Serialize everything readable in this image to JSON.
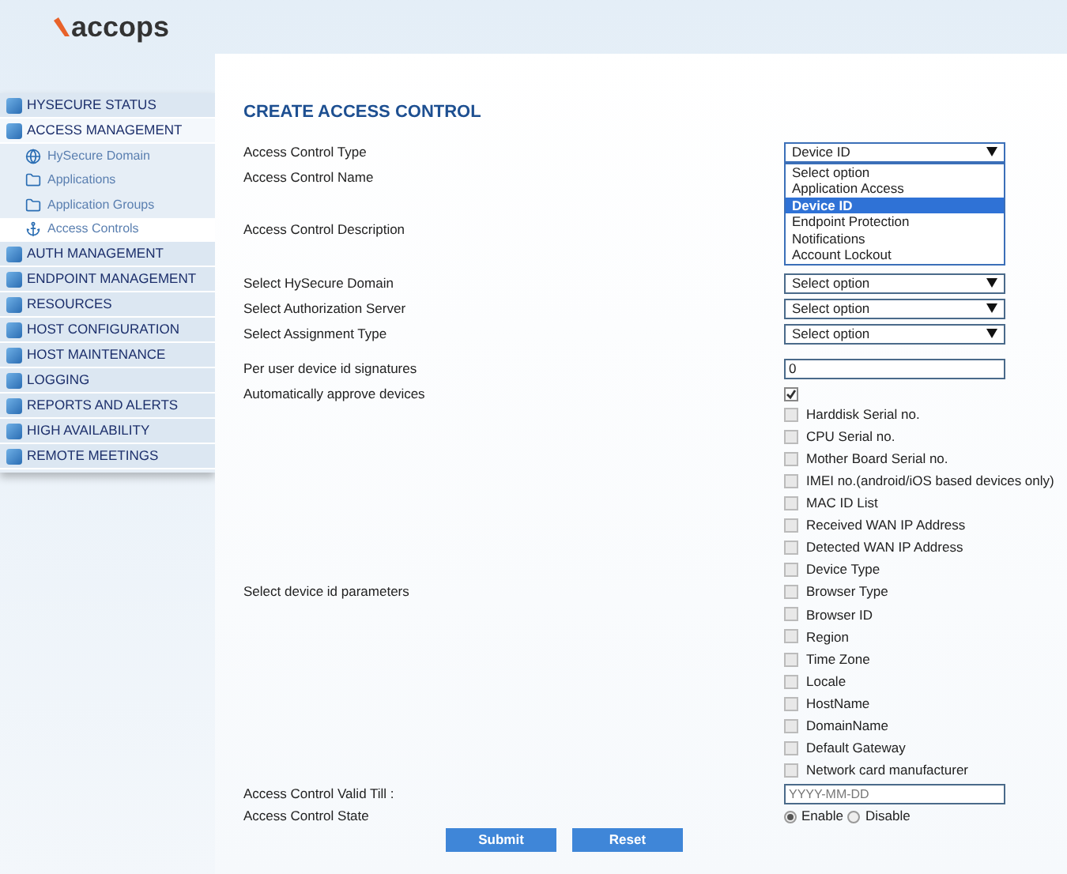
{
  "logo": "accops",
  "sidebar": {
    "items": [
      {
        "label": "HYSECURE STATUS",
        "expanded": false
      },
      {
        "label": "ACCESS MANAGEMENT",
        "expanded": true,
        "children": [
          {
            "label": "HySecure Domain",
            "selected": false
          },
          {
            "label": "Applications",
            "selected": false
          },
          {
            "label": "Application Groups",
            "selected": false
          },
          {
            "label": "Access Controls",
            "selected": true
          }
        ]
      },
      {
        "label": "AUTH MANAGEMENT",
        "expanded": false
      },
      {
        "label": "ENDPOINT MANAGEMENT",
        "expanded": false
      },
      {
        "label": "RESOURCES",
        "expanded": false
      },
      {
        "label": "HOST CONFIGURATION",
        "expanded": false
      },
      {
        "label": "HOST MAINTENANCE",
        "expanded": false
      },
      {
        "label": "LOGGING",
        "expanded": false
      },
      {
        "label": "REPORTS AND ALERTS",
        "expanded": false
      },
      {
        "label": "HIGH AVAILABILITY",
        "expanded": false
      },
      {
        "label": "REMOTE MEETINGS",
        "expanded": false
      }
    ]
  },
  "form": {
    "title": "CREATE ACCESS CONTROL",
    "access_control_type": {
      "label": "Access Control Type",
      "value": "Device ID",
      "expanded": true,
      "options": [
        {
          "label": "Select option",
          "selected": false
        },
        {
          "label": "Application Access",
          "selected": false
        },
        {
          "label": "Device ID",
          "selected": true
        },
        {
          "label": "Endpoint Protection",
          "selected": false
        },
        {
          "label": "Notifications",
          "selected": false
        },
        {
          "label": "Account Lockout",
          "selected": false
        }
      ]
    },
    "name_label": "Access Control Name",
    "description_label": "Access Control Description",
    "selects": [
      {
        "label": "Select HySecure Domain",
        "value": "Select option"
      },
      {
        "label": "Select Authorization Server",
        "value": "Select option"
      },
      {
        "label": "Select Assignment Type",
        "value": "Select option"
      }
    ],
    "signatures": {
      "label": "Per user device id signatures",
      "value": "0"
    },
    "auto_approve": {
      "label": "Automatically approve devices",
      "checked": true
    },
    "device_params": {
      "label": "Select device id parameters",
      "options": [
        {
          "label": "Harddisk Serial no.",
          "checked": false
        },
        {
          "label": "CPU Serial no.",
          "checked": false
        },
        {
          "label": "Mother Board Serial no.",
          "checked": false
        },
        {
          "label": "IMEI no.(android/iOS based devices only)",
          "checked": false
        },
        {
          "label": "MAC ID List",
          "checked": false
        },
        {
          "label": "Received WAN IP Address",
          "checked": false
        },
        {
          "label": "Detected WAN IP Address",
          "checked": false
        },
        {
          "label": "Device Type",
          "checked": false
        },
        {
          "label": "Browser Type",
          "checked": false
        },
        {
          "label": "Browser ID",
          "checked": false
        },
        {
          "label": "Region",
          "checked": false
        },
        {
          "label": "Time Zone",
          "checked": false
        },
        {
          "label": "Locale",
          "checked": false
        },
        {
          "label": "HostName",
          "checked": false
        },
        {
          "label": "DomainName",
          "checked": false
        },
        {
          "label": "Default Gateway",
          "checked": false
        },
        {
          "label": "Network card manufacturer",
          "checked": false
        }
      ]
    },
    "valid_till": {
      "label": "Access Control Valid Till :",
      "placeholder": "YYYY-MM-DD"
    },
    "state": {
      "label": "Access Control State",
      "options": [
        {
          "label": "Enable",
          "selected": true
        },
        {
          "label": "Disable",
          "selected": false
        }
      ]
    },
    "buttons": [
      "Submit",
      "Reset"
    ]
  }
}
